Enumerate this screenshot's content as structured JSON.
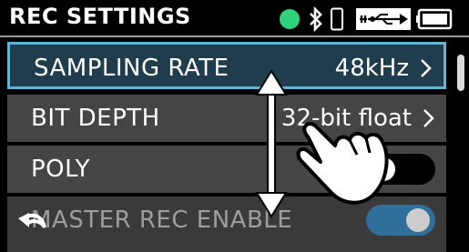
{
  "header": {
    "title": "REC SETTINGS",
    "status_color": "#2fd37b",
    "icons": [
      "status-dot",
      "bluetooth-icon",
      "phone-icon",
      "usb-power-icon",
      "battery-icon"
    ]
  },
  "menu": {
    "items": [
      {
        "label": "SAMPLING RATE",
        "value": "48kHz",
        "selected": true
      },
      {
        "label": "BIT DEPTH",
        "value": "32-bit float",
        "selected": false
      },
      {
        "label": "POLY",
        "toggle": "off"
      },
      {
        "label": "MASTER REC ENABLE",
        "toggle": "on"
      }
    ]
  },
  "colors": {
    "selected_border": "#5fb6d8",
    "selected_bg": "#1f3d4d",
    "row_bg": "#454545",
    "toggle_on": "#2f6f9a"
  },
  "gesture": {
    "type": "drag-vertical",
    "icon": "hand-swipe-icon"
  }
}
